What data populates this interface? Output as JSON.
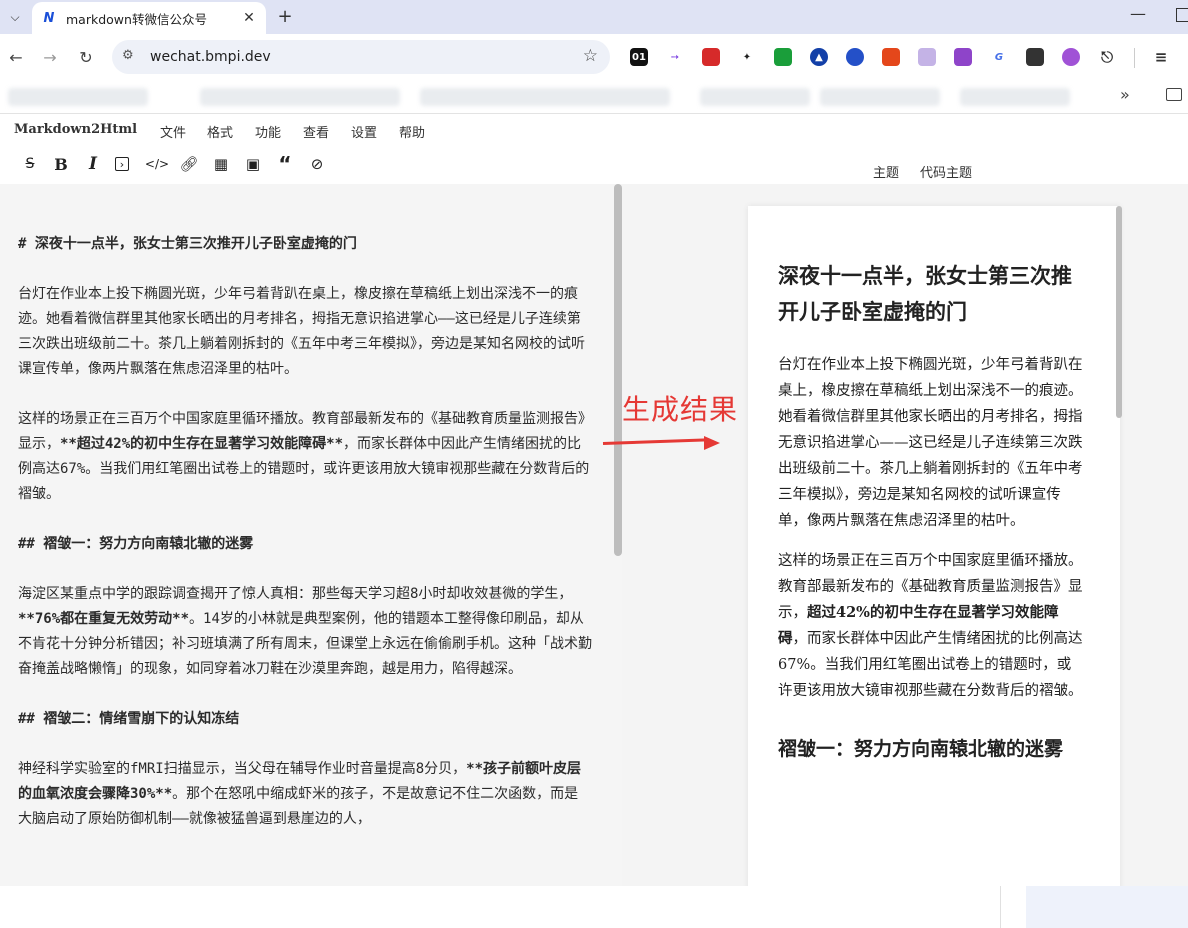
{
  "browser": {
    "tab_title": "markdown转微信公众号",
    "tab_favicon": "N",
    "url": "wechat.bmpi.dev",
    "bookmark_more": "»"
  },
  "app": {
    "brand": "Markdown2Html",
    "menu": [
      "文件",
      "格式",
      "功能",
      "查看",
      "设置",
      "帮助"
    ],
    "right_links": {
      "theme": "主题",
      "code_theme": "代码主题"
    },
    "annotation": "生成结果"
  },
  "editor": {
    "h1": "# 深夜十一点半，张女士第三次推开儿子卧室虚掩的门",
    "p1": "台灯在作业本上投下椭圆光斑，少年弓着背趴在桌上，橡皮擦在草稿纸上划出深浅不一的痕迹。她看着微信群里其他家长晒出的月考排名，拇指无意识掐进掌心——这已经是儿子连续第三次跌出班级前二十。茶几上躺着刚拆封的《五年中考三年模拟》，旁边是某知名网校的试听课宣传单，像两片飘落在焦虑沼泽里的枯叶。",
    "p2_a": "这样的场景正在三百万个中国家庭里循环播放。教育部最新发布的《基础教育质量监测报告》显示，",
    "p2_b": "**超过42%的初中生存在显著学习效能障碍**",
    "p2_c": "，而家长群体中因此产生情绪困扰的比例高达67%。当我们用红笔圈出试卷上的错题时，或许更该用放大镜审视那些藏在分数背后的褶皱。",
    "h2a": "## 褶皱一：努力方向南辕北辙的迷雾",
    "p3_a": "海淀区某重点中学的跟踪调查揭开了惊人真相：那些每天学习超8小时却收效甚微的学生，",
    "p3_b": "**76%都在重复无效劳动**",
    "p3_c": "。14岁的小林就是典型案例，他的错题本工整得像印刷品，却从不肯花十分钟分析错因；补习班填满了所有周末，但课堂上永远在偷偷刷手机。这种「战术勤奋掩盖战略懒惰」的现象，如同穿着冰刀鞋在沙漠里奔跑，越是用力，陷得越深。",
    "h2b": "## 褶皱二：情绪雪崩下的认知冻结",
    "p4_a": "神经科学实验室的fMRI扫描显示，当父母在辅导作业时音量提高8分贝，",
    "p4_b": "**孩子前额叶皮层的血氧浓度会骤降30%**",
    "p4_c": "。那个在怒吼中缩成虾米的孩子，不是故意记不住二次函数，而是大脑启动了原始防御机制——就像被猛兽逼到悬崖边的人，"
  },
  "preview": {
    "h1": "深夜十一点半，张女士第三次推开儿子卧室虚掩的门",
    "p1": "台灯在作业本上投下椭圆光斑，少年弓着背趴在桌上，橡皮擦在草稿纸上划出深浅不一的痕迹。她看着微信群里其他家长晒出的月考排名，拇指无意识掐进掌心——这已经是儿子连续第三次跌出班级前二十。茶几上躺着刚拆封的《五年中考三年模拟》，旁边是某知名网校的试听课宣传单，像两片飘落在焦虑沼泽里的枯叶。",
    "p2_a": "这样的场景正在三百万个中国家庭里循环播放。教育部最新发布的《基础教育质量监测报告》显示，",
    "p2_b": "超过42%的初中生存在显著学习效能障碍",
    "p2_c": "，而家长群体中因此产生情绪困扰的比例高达67%。当我们用红笔圈出试卷上的错题时，或许更该用放大镜审视那些藏在分数背后的褶皱。",
    "h2": "褶皱一：努力方向南辕北辙的迷雾"
  },
  "colors": {
    "accent_red": "#e53935",
    "tab_strip": "#dfe3f4",
    "editor_bg": "#f5f5f5"
  },
  "icons": [
    "chevron-down-icon",
    "close-icon",
    "plus-icon",
    "back-icon",
    "forward-icon",
    "reload-icon",
    "site-settings-icon",
    "star-icon",
    "strikethrough-icon",
    "bold-icon",
    "italic-icon",
    "code-block-icon",
    "code-icon",
    "link-icon",
    "table-icon",
    "image-icon",
    "quote-icon",
    "clear-format-icon",
    "folder-icon"
  ]
}
